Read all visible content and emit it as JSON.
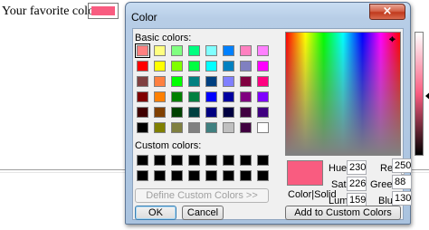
{
  "page": {
    "label": "Your favorite color:",
    "swatch_color": "#f95c80"
  },
  "dialog": {
    "title": "Color",
    "close_icon": "×",
    "basic_colors_label": "Basic colors:",
    "custom_colors_label": "Custom colors:",
    "define_custom_label": "Define Custom Colors >>",
    "ok_label": "OK",
    "cancel_label": "Cancel",
    "add_custom_label": "Add to Custom Colors",
    "color_solid_label": "Color|Solid",
    "current_color": "#f95c80",
    "basic_colors": [
      "#ff8080",
      "#ffff80",
      "#80ff80",
      "#00ff80",
      "#80ffff",
      "#0080ff",
      "#ff80c0",
      "#ff80ff",
      "#ff0000",
      "#ffff00",
      "#80ff00",
      "#00ff40",
      "#00ffff",
      "#0080c0",
      "#8080c0",
      "#ff00ff",
      "#804040",
      "#ff8040",
      "#00ff00",
      "#008080",
      "#004080",
      "#8080ff",
      "#800040",
      "#ff0080",
      "#800000",
      "#ff8000",
      "#008000",
      "#008040",
      "#0000ff",
      "#0000a0",
      "#800080",
      "#8000ff",
      "#400000",
      "#804000",
      "#004000",
      "#004040",
      "#000080",
      "#000040",
      "#400040",
      "#400080",
      "#000000",
      "#808000",
      "#808040",
      "#808080",
      "#408080",
      "#c0c0c0",
      "#400040",
      "#ffffff"
    ],
    "custom_colors": [
      "#000000",
      "#000000",
      "#000000",
      "#000000",
      "#000000",
      "#000000",
      "#000000",
      "#000000",
      "#000000",
      "#000000",
      "#000000",
      "#000000",
      "#000000",
      "#000000",
      "#000000",
      "#000000"
    ],
    "hue_label": "Hue:",
    "hue_value": "230",
    "sat_label": "Sat:",
    "sat_value": "226",
    "lum_label": "Lum:",
    "lum_value": "159",
    "red_label": "Red:",
    "red_value": "250",
    "green_label": "Green:",
    "green_value": "88",
    "blue_label": "Blue:",
    "blue_value": "130"
  }
}
